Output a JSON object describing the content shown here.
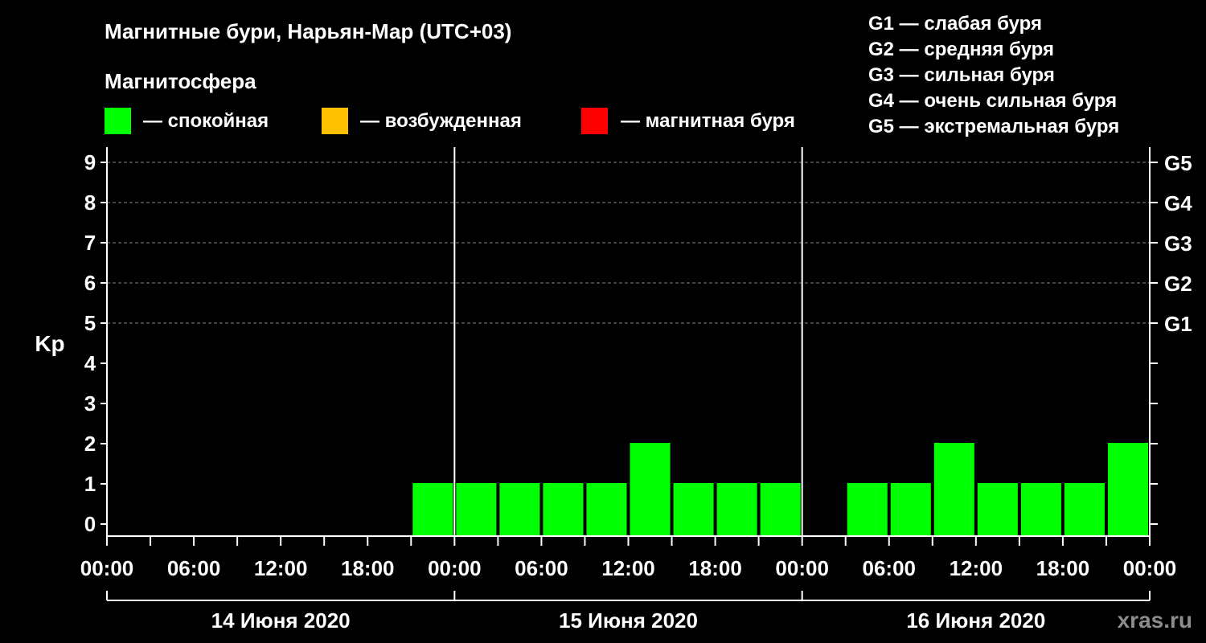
{
  "chart_data": {
    "type": "bar",
    "title": "Магнитные бури, Нарьян-Мар (UTC+03)",
    "legend_title": "Магнитосфера",
    "legend": [
      {
        "label": "— спокойная",
        "color": "#00ff00"
      },
      {
        "label": "— возбужденная",
        "color": "#ffc000"
      },
      {
        "label": "— магнитная буря",
        "color": "#ff0000"
      }
    ],
    "storm_scale": [
      "G1 — слабая буря",
      "G2 — средняя буря",
      "G3 — сильная буря",
      "G4 — очень сильная буря",
      "G5 — экстремальная буря"
    ],
    "ylabel": "Kp",
    "ylim": [
      0,
      9
    ],
    "y_ticks": [
      "0",
      "1",
      "2",
      "3",
      "4",
      "5",
      "6",
      "7",
      "8",
      "9"
    ],
    "right_ticks": [
      {
        "kp": 5,
        "label": "G1"
      },
      {
        "kp": 6,
        "label": "G2"
      },
      {
        "kp": 7,
        "label": "G3"
      },
      {
        "kp": 8,
        "label": "G4"
      },
      {
        "kp": 9,
        "label": "G5"
      }
    ],
    "x_ticks": [
      "00:00",
      "06:00",
      "12:00",
      "18:00",
      "00:00",
      "06:00",
      "12:00",
      "18:00",
      "00:00",
      "06:00",
      "12:00",
      "18:00",
      "00:00"
    ],
    "days": [
      "14 Июня 2020",
      "15 Июня 2020",
      "16 Июня 2020"
    ],
    "interval_hours": 3,
    "values": [
      null,
      null,
      null,
      null,
      null,
      null,
      null,
      1,
      1,
      1,
      1,
      1,
      2,
      1,
      1,
      1,
      null,
      1,
      1,
      2,
      1,
      1,
      1,
      2
    ],
    "bar_color": "#00ff00",
    "grid": true
  },
  "watermark": "xras.ru"
}
